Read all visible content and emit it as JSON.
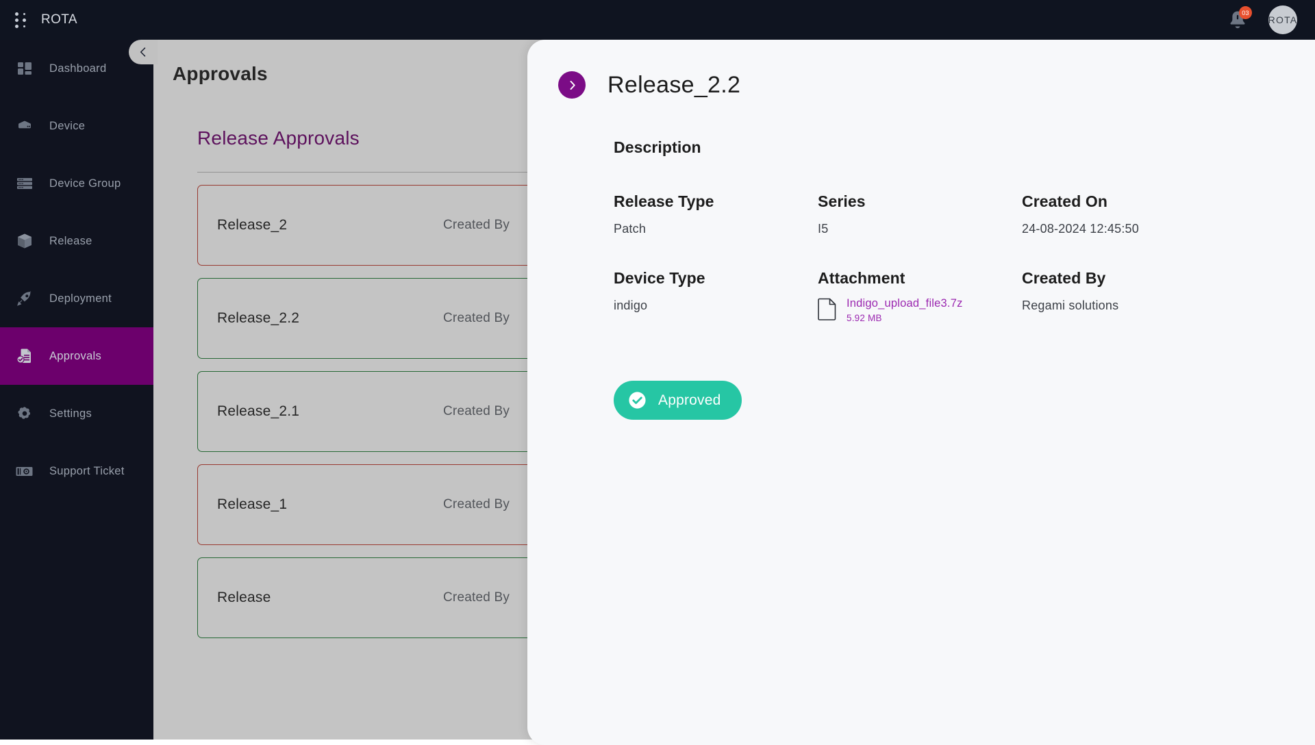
{
  "topbar": {
    "brand_name": "ROTA",
    "logo_icon": "dot-grid-logo",
    "notification_icon": "bell-icon",
    "notification_count": "03",
    "avatar_initials": "ROTA"
  },
  "sidebar": {
    "collapse_icon": "chevron-left-icon",
    "items": [
      {
        "label": "Dashboard",
        "icon": "dashboard-grid-icon",
        "active": false
      },
      {
        "label": "Device",
        "icon": "device-server-icon",
        "active": false
      },
      {
        "label": "Device Group",
        "icon": "device-group-icon",
        "active": false
      },
      {
        "label": "Release",
        "icon": "box-package-icon",
        "active": false
      },
      {
        "label": "Deployment",
        "icon": "rocket-icon",
        "active": false
      },
      {
        "label": "Approvals",
        "icon": "document-check-icon",
        "active": true
      },
      {
        "label": "Settings",
        "icon": "gear-icon",
        "active": false
      },
      {
        "label": "Support Ticket",
        "icon": "ticket-icon",
        "active": false
      }
    ]
  },
  "page": {
    "title": "Approvals",
    "section_title": "Release Approvals",
    "releases": [
      {
        "name": "Release_2",
        "meta": "Created By",
        "status": "red"
      },
      {
        "name": "Release_2.2",
        "meta": "Created By",
        "status": "green"
      },
      {
        "name": "Release_2.1",
        "meta": "Created By",
        "status": "green"
      },
      {
        "name": "Release_1",
        "meta": "Created By",
        "status": "red"
      },
      {
        "name": "Release",
        "meta": "Created By",
        "status": "green"
      }
    ]
  },
  "drawer": {
    "toggle_icon": "chevron-right-icon",
    "title": "Release_2.2",
    "description_label": "Description",
    "fields": {
      "release_type_label": "Release Type",
      "release_type_value": "Patch",
      "series_label": "Series",
      "series_value": "I5",
      "created_on_label": "Created On",
      "created_on_value": "24-08-2024 12:45:50",
      "device_type_label": "Device Type",
      "device_type_value": "indigo",
      "attachment_label": "Attachment",
      "attachment_icon": "file-document-icon",
      "attachment_name": "Indigo_upload_file3.7z",
      "attachment_size": "5.92 MB",
      "created_by_label": "Created By",
      "created_by_value": "Regami solutions"
    },
    "approved_button_label": "Approved",
    "approved_button_icon": "check-circle-icon"
  },
  "colors": {
    "brand_purple": "#6C006C",
    "accent_purple": "#7B0C86",
    "link_purple": "#9B27B0",
    "approved_teal": "#26C6A4",
    "status_red": "#C0392B",
    "status_green": "#1E7B33",
    "sidebar_bg": "#10131F",
    "topbar_bg": "#0F1420",
    "badge_red": "#E8502E"
  }
}
